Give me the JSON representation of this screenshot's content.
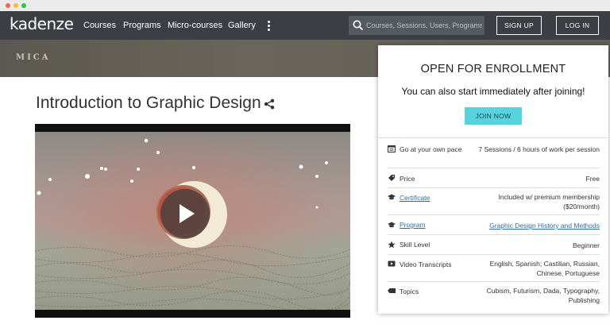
{
  "nav": {
    "logo": "kadenze",
    "links": [
      "Courses",
      "Programs",
      "Micro-courses",
      "Gallery"
    ],
    "search_placeholder": "Courses, Sessions, Users, Programs",
    "signup_label": "SIGN UP",
    "login_label": "LOG IN"
  },
  "banner": {
    "partner": "MICA"
  },
  "course": {
    "title": "Introduction to Graphic Design"
  },
  "enroll": {
    "heading": "OPEN FOR ENROLLMENT",
    "subheading": "You can also start immediately after joining!",
    "join_label": "JOIN NOW",
    "details": [
      {
        "icon": "calendar-icon",
        "label": "Go at your own pace",
        "value": "7 Sessions / 6 hours of work per session"
      },
      {
        "icon": "price-tag-icon",
        "label": "Price",
        "value": "Free"
      },
      {
        "icon": "graduation-cap-icon",
        "label": "Certificate",
        "value": "Included w/ premium membership ($20/month)"
      },
      {
        "icon": "graduation-cap-icon",
        "label": "Program",
        "value": "Graphic Design History and Methods"
      },
      {
        "icon": "star-icon",
        "label": "Skill Level",
        "value": "Beginner"
      },
      {
        "icon": "video-icon",
        "label": "Video Transcripts",
        "value": "English, Spanish; Castilian, Russian, Chinese, Portuguese"
      },
      {
        "icon": "tag-icon",
        "label": "Topics",
        "value": "Cubism, Futurism, Dada, Typography, Publishing"
      }
    ]
  },
  "colors": {
    "navbar": "#3b3f44",
    "accent": "#58d3dd",
    "link": "#2a6fa0"
  }
}
